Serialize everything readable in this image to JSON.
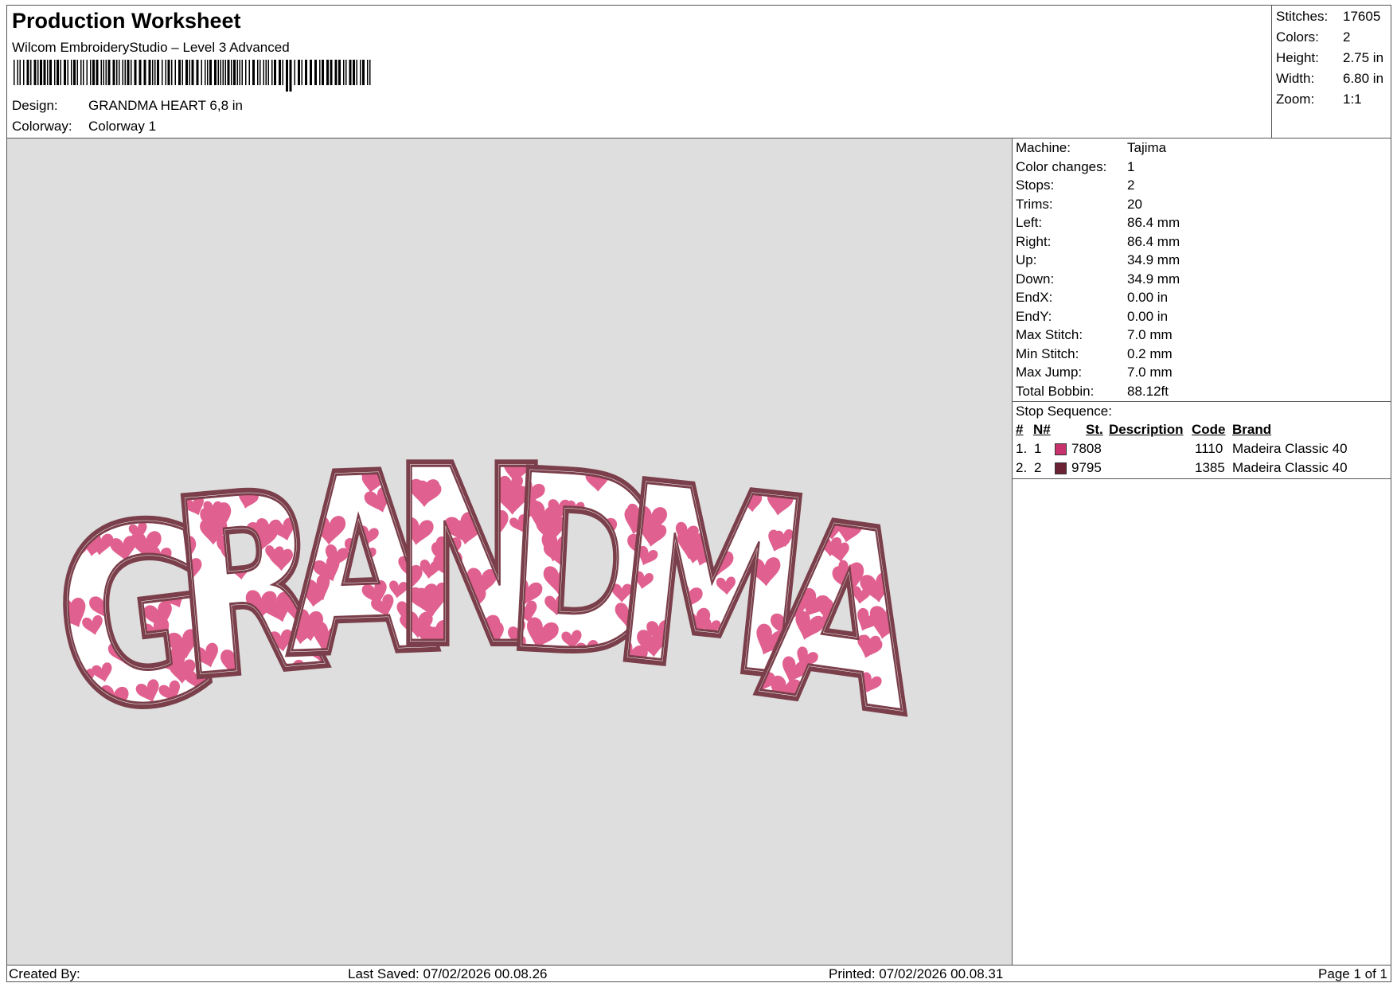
{
  "header": {
    "title": "Production Worksheet",
    "software": "Wilcom EmbroideryStudio – Level 3 Advanced",
    "design_label": "Design:",
    "design_value": "GRANDMA HEART 6,8 in",
    "colorway_label": "Colorway:",
    "colorway_value": "Colorway 1"
  },
  "stats": [
    {
      "label": "Stitches:",
      "value": "17605"
    },
    {
      "label": "Colors:",
      "value": "2"
    },
    {
      "label": "Height:",
      "value": "2.75 in"
    },
    {
      "label": "Width:",
      "value": "6.80 in"
    },
    {
      "label": "Zoom:",
      "value": "1:1"
    }
  ],
  "machine_info": [
    {
      "label": "Machine:",
      "value": "Tajima"
    },
    {
      "label": "Color changes:",
      "value": "1"
    },
    {
      "label": "Stops:",
      "value": "2"
    },
    {
      "label": "Trims:",
      "value": "20"
    },
    {
      "label": "Left:",
      "value": "86.4 mm"
    },
    {
      "label": "Right:",
      "value": "86.4 mm"
    },
    {
      "label": "Up:",
      "value": "34.9 mm"
    },
    {
      "label": "Down:",
      "value": "34.9 mm"
    },
    {
      "label": "EndX:",
      "value": "0.00 in"
    },
    {
      "label": "EndY:",
      "value": "0.00 in"
    },
    {
      "label": "Max Stitch:",
      "value": "7.0 mm"
    },
    {
      "label": "Min Stitch:",
      "value": "0.2 mm"
    },
    {
      "label": "Max Jump:",
      "value": "7.0 mm"
    },
    {
      "label": "Total Bobbin:",
      "value": "88.12ft"
    }
  ],
  "stop_sequence": {
    "title": "Stop Sequence:",
    "columns": [
      "#",
      "N#",
      "St.",
      "Description",
      "Code",
      "Brand"
    ],
    "rows": [
      {
        "num": "1.",
        "n": "1",
        "color": "#c8336e",
        "st": "7808",
        "description": "",
        "code": "1110",
        "brand": "Madeira Classic 40"
      },
      {
        "num": "2.",
        "n": "2",
        "color": "#6b2235",
        "st": "9795",
        "description": "",
        "code": "1385",
        "brand": "Madeira Classic 40"
      }
    ]
  },
  "design": {
    "text": "GRANDMA",
    "outline_color": "#7a3f4a",
    "fill_color": "#ffffff",
    "heart_color": "#e0608f"
  },
  "footer": {
    "created_by": "Created By:",
    "last_saved": "Last Saved: 07/02/2026 00.08.26",
    "printed": "Printed: 07/02/2026 00.08.31",
    "page": "Page 1 of 1"
  }
}
